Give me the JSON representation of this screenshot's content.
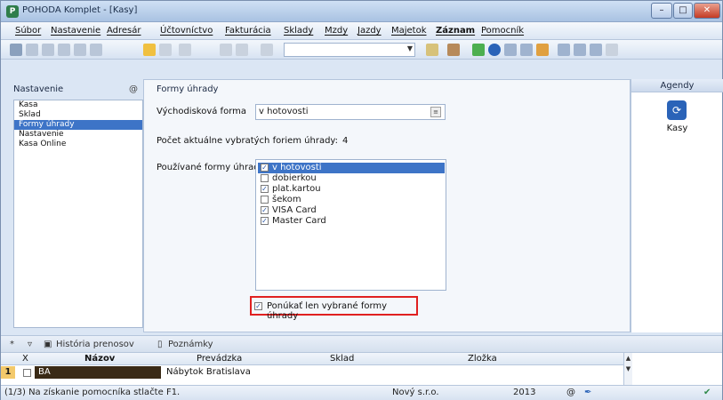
{
  "window": {
    "title": "POHODA Komplet - [Kasy]"
  },
  "menu": [
    "Súbor",
    "Nastavenie",
    "Adresár",
    "Účtovníctvo",
    "Fakturácia",
    "Sklady",
    "Mzdy",
    "Jazdy",
    "Majetok",
    "Záznam",
    "Pomocník"
  ],
  "left_panel": {
    "header": "Nastavenie",
    "header_symbol": "@",
    "items": [
      "Kasa",
      "Sklad",
      "Formy úhrady",
      "Nastavenie",
      "Kasa Online"
    ],
    "selected_index": 2
  },
  "main": {
    "header": "Formy úhrady",
    "default_form_label": "Východisková forma",
    "default_form_value": "v hotovosti",
    "count_label": "Počet aktuálne vybratých foriem úhrady:",
    "count_value": "4",
    "used_forms_label": "Používané formy úhrad",
    "forms": [
      {
        "label": "v hotovosti",
        "checked": true,
        "selected": true
      },
      {
        "label": "dobierkou",
        "checked": false,
        "selected": false
      },
      {
        "label": "plat.kartou",
        "checked": true,
        "selected": false
      },
      {
        "label": "šekom",
        "checked": false,
        "selected": false
      },
      {
        "label": "VISA Card",
        "checked": true,
        "selected": false
      },
      {
        "label": "Master Card",
        "checked": true,
        "selected": false
      }
    ],
    "offer_only_label": "Ponúkať len vybrané formy úhrady",
    "offer_only_checked": true
  },
  "right_panel": {
    "header": "Agendy",
    "item": "Kasy"
  },
  "tabs": {
    "history": "História prenosov",
    "notes": "Poznámky"
  },
  "grid": {
    "columns": [
      "X",
      "Názov",
      "Prevádzka",
      "Sklad",
      "Zložka"
    ],
    "rows": [
      {
        "num": "1",
        "x": "",
        "name": "BA",
        "prevadzka": "Nábytok Bratislava",
        "sklad": "",
        "zlozka": ""
      }
    ]
  },
  "status": {
    "hint": "(1/3) Na získanie pomocníka stlačte F1.",
    "company": "Nový s.r.o.",
    "year": "2013"
  },
  "colors": {
    "selection": "#3d74c7",
    "highlight_border": "#e02020",
    "rownum": "#f3c96b"
  }
}
